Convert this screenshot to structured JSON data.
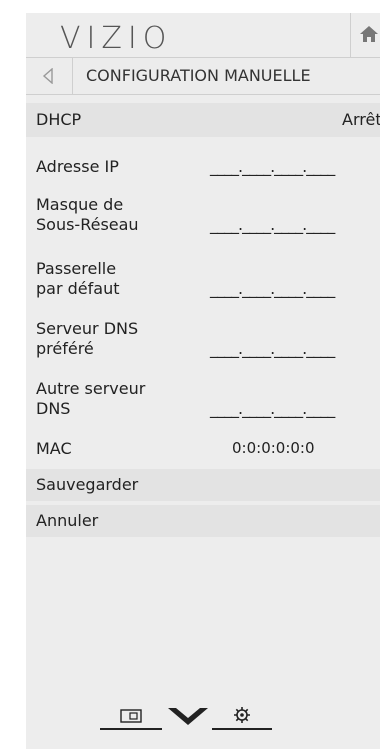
{
  "header": {
    "logo": "VIZIO",
    "home_icon": "home-icon"
  },
  "titlebar": {
    "back_icon": "back-arrow-icon",
    "title": "CONFIGURATION MANUELLE"
  },
  "dhcp": {
    "label": "DHCP",
    "value": "Arrêt"
  },
  "fields": {
    "ip": {
      "label": "Adresse IP",
      "value": "____.____.____.____"
    },
    "mask": {
      "label1": "Masque de",
      "label2": "Sous-Réseau",
      "value": "____.____.____.____"
    },
    "gateway": {
      "label1": "Passerelle",
      "label2": "par défaut",
      "value": "____.____.____.____"
    },
    "dns1": {
      "label1": "Serveur DNS",
      "label2": "préféré",
      "value": "____.____.____.____"
    },
    "dns2": {
      "label1": "Autre serveur",
      "label2": "DNS",
      "value": "____.____.____.____"
    },
    "mac": {
      "label": "MAC",
      "value": "0:0:0:0:0:0"
    }
  },
  "actions": {
    "save": "Sauvegarder",
    "cancel": "Annuler"
  },
  "bottom_icons": [
    "input-icon",
    "chevron-down-icon",
    "gear-icon"
  ]
}
